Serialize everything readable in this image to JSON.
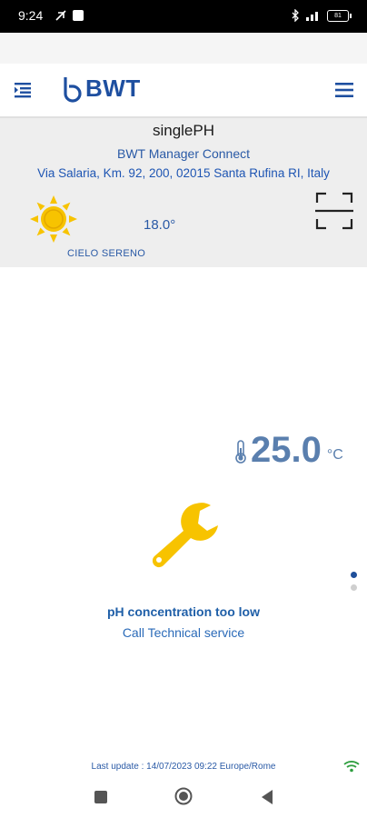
{
  "status_bar": {
    "time": "9:24",
    "battery": "81"
  },
  "header": {
    "brand": "BWT",
    "left_icon": "collapse-menu-icon",
    "right_icon": "hamburger-menu-icon"
  },
  "device": {
    "name": "singlePH",
    "manager": "BWT Manager Connect",
    "address": "Via Salaria, Km. 92, 200, 02015 Santa Rufina RI, Italy"
  },
  "weather": {
    "icon": "sun-icon",
    "temperature": "18.0°",
    "description": "CIELO SERENO"
  },
  "water": {
    "temperature": "25.0",
    "unit": "°C"
  },
  "alert": {
    "icon": "wrench-icon",
    "title": "pH concentration too low",
    "subtitle": "Call Technical service"
  },
  "pager": {
    "pages": 2,
    "active": 1
  },
  "footer": {
    "last_update": "Last update : 14/07/2023 09:22 Europe/Rome"
  },
  "colors": {
    "brand_blue": "#1e4fa0",
    "sun_yellow": "#f7c300",
    "wrench_yellow": "#f7c300",
    "wifi_green": "#2e9e3e",
    "panel_bg": "#eeeeee"
  }
}
